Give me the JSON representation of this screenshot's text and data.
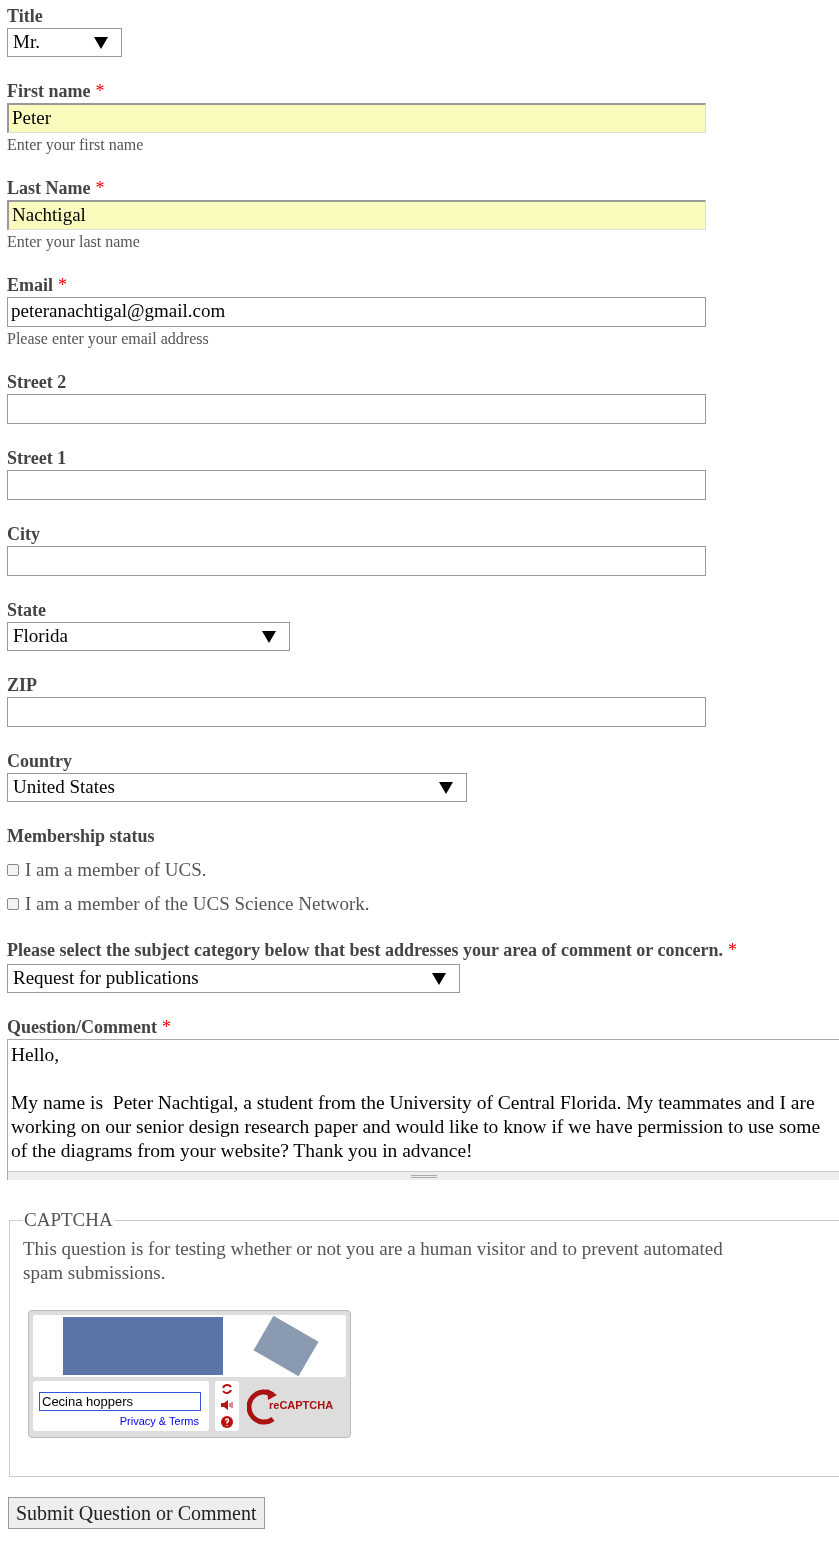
{
  "fields": [
    {
      "kind": "select",
      "label": "Title",
      "value": "Mr."
    },
    {
      "kind": "text",
      "label": "First name",
      "required_mark": "*",
      "value": "Peter",
      "hint": "Enter your first name",
      "highlighted": true
    },
    {
      "kind": "text",
      "label": "Last Name",
      "required_mark": "*",
      "value": "Nachtigal",
      "hint": "Enter your last name",
      "highlighted": true
    },
    {
      "kind": "text",
      "label": "Email",
      "required_mark": "*",
      "value": "peteranachtigal@gmail.com",
      "hint": "Please enter your email address",
      "highlighted": false
    },
    {
      "kind": "text",
      "label": "Street 2",
      "highlighted": false
    },
    {
      "kind": "text",
      "label": "Street 1",
      "highlighted": false
    },
    {
      "kind": "text",
      "label": "City",
      "highlighted": false
    },
    {
      "kind": "select",
      "label": "State",
      "value": "Florida"
    },
    {
      "kind": "text",
      "label": "ZIP",
      "highlighted": false
    },
    {
      "kind": "select",
      "label": "Country",
      "value": "United States"
    }
  ],
  "membership": {
    "label": "Membership status",
    "options": [
      {
        "label": "I am a member of UCS.",
        "checked": false
      },
      {
        "label": "I am a member of the UCS Science Network.",
        "checked": false
      }
    ]
  },
  "subject": {
    "label": "Please select the subject category below that best addresses your area of comment or concern.",
    "required_mark": "*",
    "value": "Request for publications"
  },
  "question": {
    "label": "Question/Comment",
    "required_mark": "*",
    "value": "Hello,\n\nMy name is  Peter Nachtigal, a student from the University of Central Florida. My teammates and I are working on our senior design research paper and would like to know if we have permission to use some of the diagrams from your website? Thank you in advance!"
  },
  "captcha": {
    "legend": "CAPTCHA",
    "description": "This question is for testing whether or not you are a human visitor and to prevent automated spam submissions.",
    "answer": "Cecina hoppers",
    "privacy_link": "Privacy & Terms",
    "logo_text": "reCAPTCHA"
  },
  "submit": "Submit Question or Comment"
}
